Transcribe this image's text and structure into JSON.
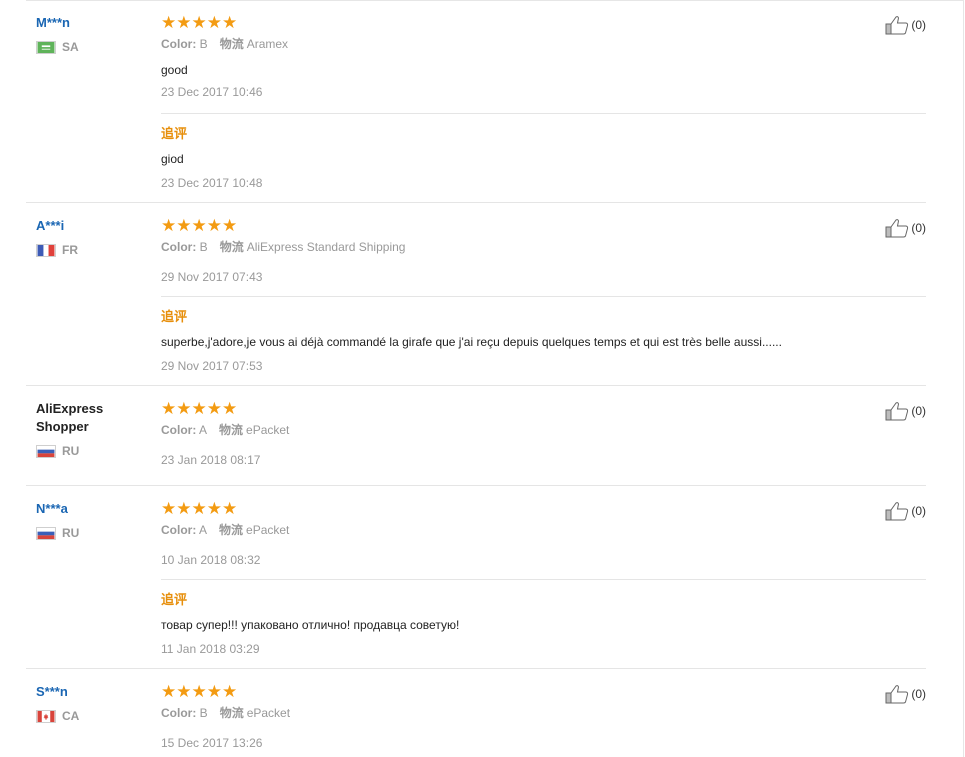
{
  "labels": {
    "color": "Color:",
    "shipping": "物流",
    "additional_feedback": "追评"
  },
  "icons": {
    "rating": "star-icon",
    "like": "thumbs-up-icon"
  },
  "star_color": "#f39b12",
  "reviews": [
    {
      "user": "M***n",
      "country": "SA",
      "flag": "saudi-arabia-flag",
      "rating": 5,
      "color": "B",
      "shipping": "Aramex",
      "text": "good",
      "date": "23 Dec 2017 10:46",
      "additional": {
        "text": "giod",
        "date": "23 Dec 2017 10:48"
      },
      "likes": "(0)"
    },
    {
      "user": "A***i",
      "country": "FR",
      "flag": "france-flag",
      "rating": 5,
      "color": "B",
      "shipping": "AliExpress Standard Shipping",
      "text": "",
      "date": "29 Nov 2017 07:43",
      "additional": {
        "text": "superbe,j'adore,je vous ai déjà commandé la girafe que j'ai reçu depuis quelques temps et qui est très belle aussi......",
        "date": "29 Nov 2017 07:53"
      },
      "likes": "(0)"
    },
    {
      "user": "AliExpress Shopper",
      "country": "RU",
      "flag": "russia-flag",
      "rating": 5,
      "color": "A",
      "shipping": "ePacket",
      "text": "",
      "date": "23 Jan 2018 08:17",
      "likes": "(0)"
    },
    {
      "user": "N***a",
      "country": "RU",
      "flag": "russia-flag",
      "rating": 5,
      "color": "A",
      "shipping": "ePacket",
      "text": "",
      "date": "10 Jan 2018 08:32",
      "additional": {
        "text": "товар супер!!! упаковано отлично! продавца советую!",
        "date": "11 Jan 2018 03:29"
      },
      "likes": "(0)"
    },
    {
      "user": "S***n",
      "country": "CA",
      "flag": "canada-flag",
      "rating": 5,
      "color": "B",
      "shipping": "ePacket",
      "text": "",
      "date": "15 Dec 2017 13:26",
      "likes": "(0)"
    }
  ]
}
